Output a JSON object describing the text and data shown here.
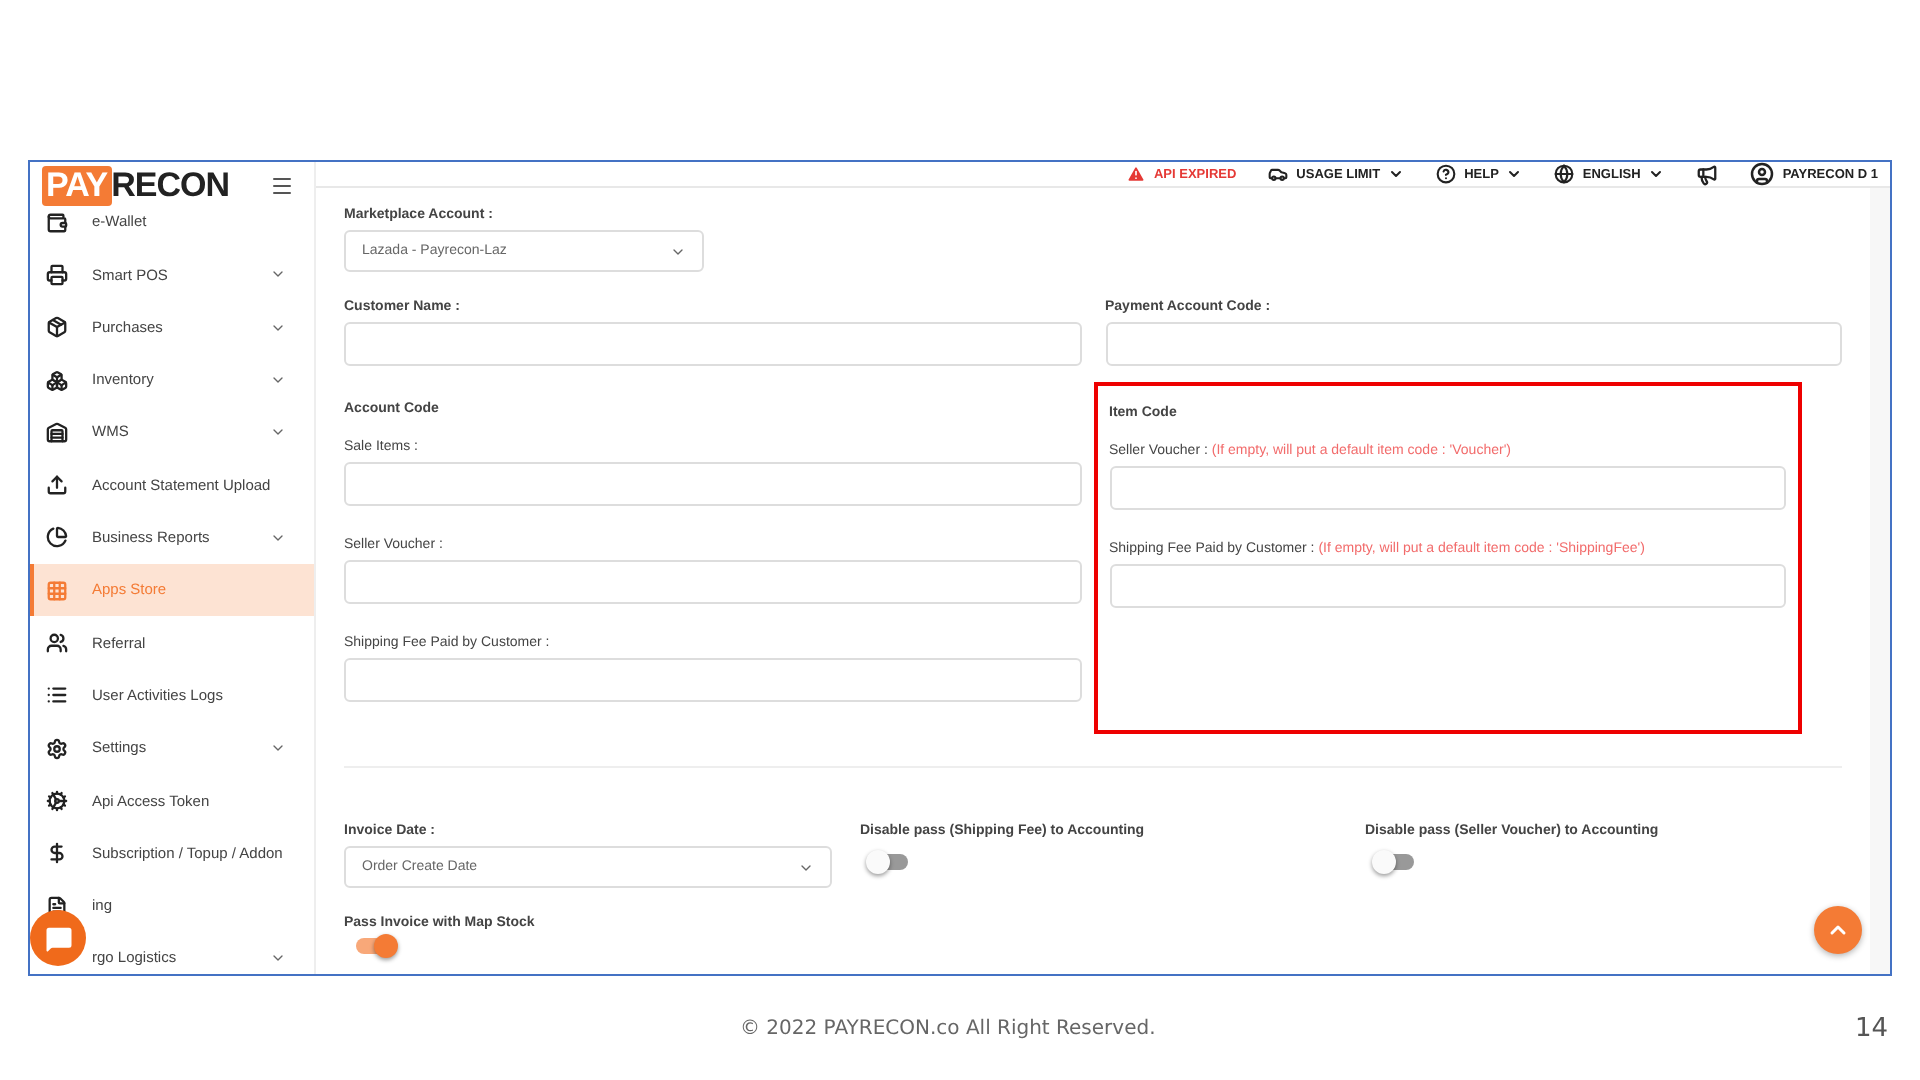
{
  "header": {
    "logo": {
      "accent": "PAY",
      "rest": "RECON"
    },
    "alert": "API EXPIRED",
    "menus": [
      {
        "label": "USAGE LIMIT"
      },
      {
        "label": "HELP"
      },
      {
        "label": "ENGLISH"
      }
    ],
    "user": "PAYRECON D 1"
  },
  "sidebar": {
    "items": [
      {
        "label": "e-Wallet",
        "expandable": false,
        "selected": false
      },
      {
        "label": "Smart POS",
        "expandable": true,
        "selected": false
      },
      {
        "label": "Purchases",
        "expandable": true,
        "selected": false
      },
      {
        "label": "Inventory",
        "expandable": true,
        "selected": false
      },
      {
        "label": "WMS",
        "expandable": true,
        "selected": false
      },
      {
        "label": "Account Statement Upload",
        "expandable": false,
        "selected": false
      },
      {
        "label": "Business Reports",
        "expandable": true,
        "selected": false
      },
      {
        "label": "Apps Store",
        "expandable": false,
        "selected": true
      },
      {
        "label": "Referral",
        "expandable": false,
        "selected": false
      },
      {
        "label": "User Activities Logs",
        "expandable": false,
        "selected": false
      },
      {
        "label": "Settings",
        "expandable": true,
        "selected": false
      },
      {
        "label": "Api Access Token",
        "expandable": false,
        "selected": false
      },
      {
        "label": "Subscription / Topup / Addon",
        "expandable": false,
        "selected": false
      },
      {
        "label": "ing",
        "expandable": false,
        "selected": false
      },
      {
        "label": "rgo Logistics",
        "expandable": true,
        "selected": false
      }
    ]
  },
  "form": {
    "marketplace": {
      "label": "Marketplace Account :",
      "value": "Lazada - Payrecon-Laz"
    },
    "customer_name": {
      "label": "Customer Name :"
    },
    "payment_account_code": {
      "label": "Payment Account Code :"
    },
    "account_code": {
      "title": "Account Code",
      "fields": [
        {
          "label": "Sale Items :"
        },
        {
          "label": "Seller Voucher :"
        },
        {
          "label": "Shipping Fee Paid by Customer :"
        }
      ]
    },
    "item_code": {
      "title": "Item Code",
      "fields": [
        {
          "label": "Seller Voucher :",
          "hint": "(If empty, will put a default item code : 'Voucher')"
        },
        {
          "label": "Shipping Fee Paid by Customer :",
          "hint": "(If empty, will put a default item code : 'ShippingFee')"
        }
      ]
    },
    "invoice_date": {
      "label": "Invoice Date :",
      "value": "Order Create Date"
    },
    "switches": [
      {
        "label": "Disable pass (Shipping Fee) to Accounting",
        "on": false
      },
      {
        "label": "Disable pass (Seller Voucher) to Accounting",
        "on": false
      }
    ],
    "pass_invoice": {
      "label": "Pass Invoice with Map Stock",
      "on": true
    }
  },
  "footer": {
    "copyright": "© 2022 PAYRECON.co All Right Reserved.",
    "page": "14"
  }
}
